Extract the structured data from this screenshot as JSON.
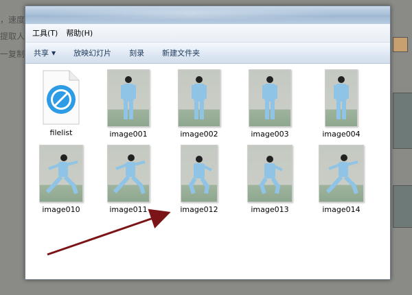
{
  "background_text": [
    "，速度",
    "提取人",
    "一复制"
  ],
  "menu": [
    "工具(T)",
    "帮助(H)"
  ],
  "toolbar": {
    "share": "共享",
    "slideshow": "放映幻灯片",
    "burn": "刻录",
    "new_folder": "新建文件夹"
  },
  "files": [
    {
      "name": "filelist",
      "type": "file"
    },
    {
      "name": "image001",
      "type": "image",
      "pose": "standing"
    },
    {
      "name": "image002",
      "type": "image",
      "pose": "standing"
    },
    {
      "name": "image003",
      "type": "image",
      "pose": "standing"
    },
    {
      "name": "image004",
      "type": "image",
      "pose": "standing"
    },
    {
      "name": "image010",
      "type": "image",
      "pose": "lunge"
    },
    {
      "name": "image011",
      "type": "image",
      "pose": "lunge"
    },
    {
      "name": "image012",
      "type": "image",
      "pose": "crouch"
    },
    {
      "name": "image013",
      "type": "image",
      "pose": "crouch"
    },
    {
      "name": "image014",
      "type": "image",
      "pose": "lunge"
    }
  ],
  "colors": {
    "arrow": "#7a1416",
    "suit": "#8fc4e6",
    "accent": "#1e395b"
  }
}
